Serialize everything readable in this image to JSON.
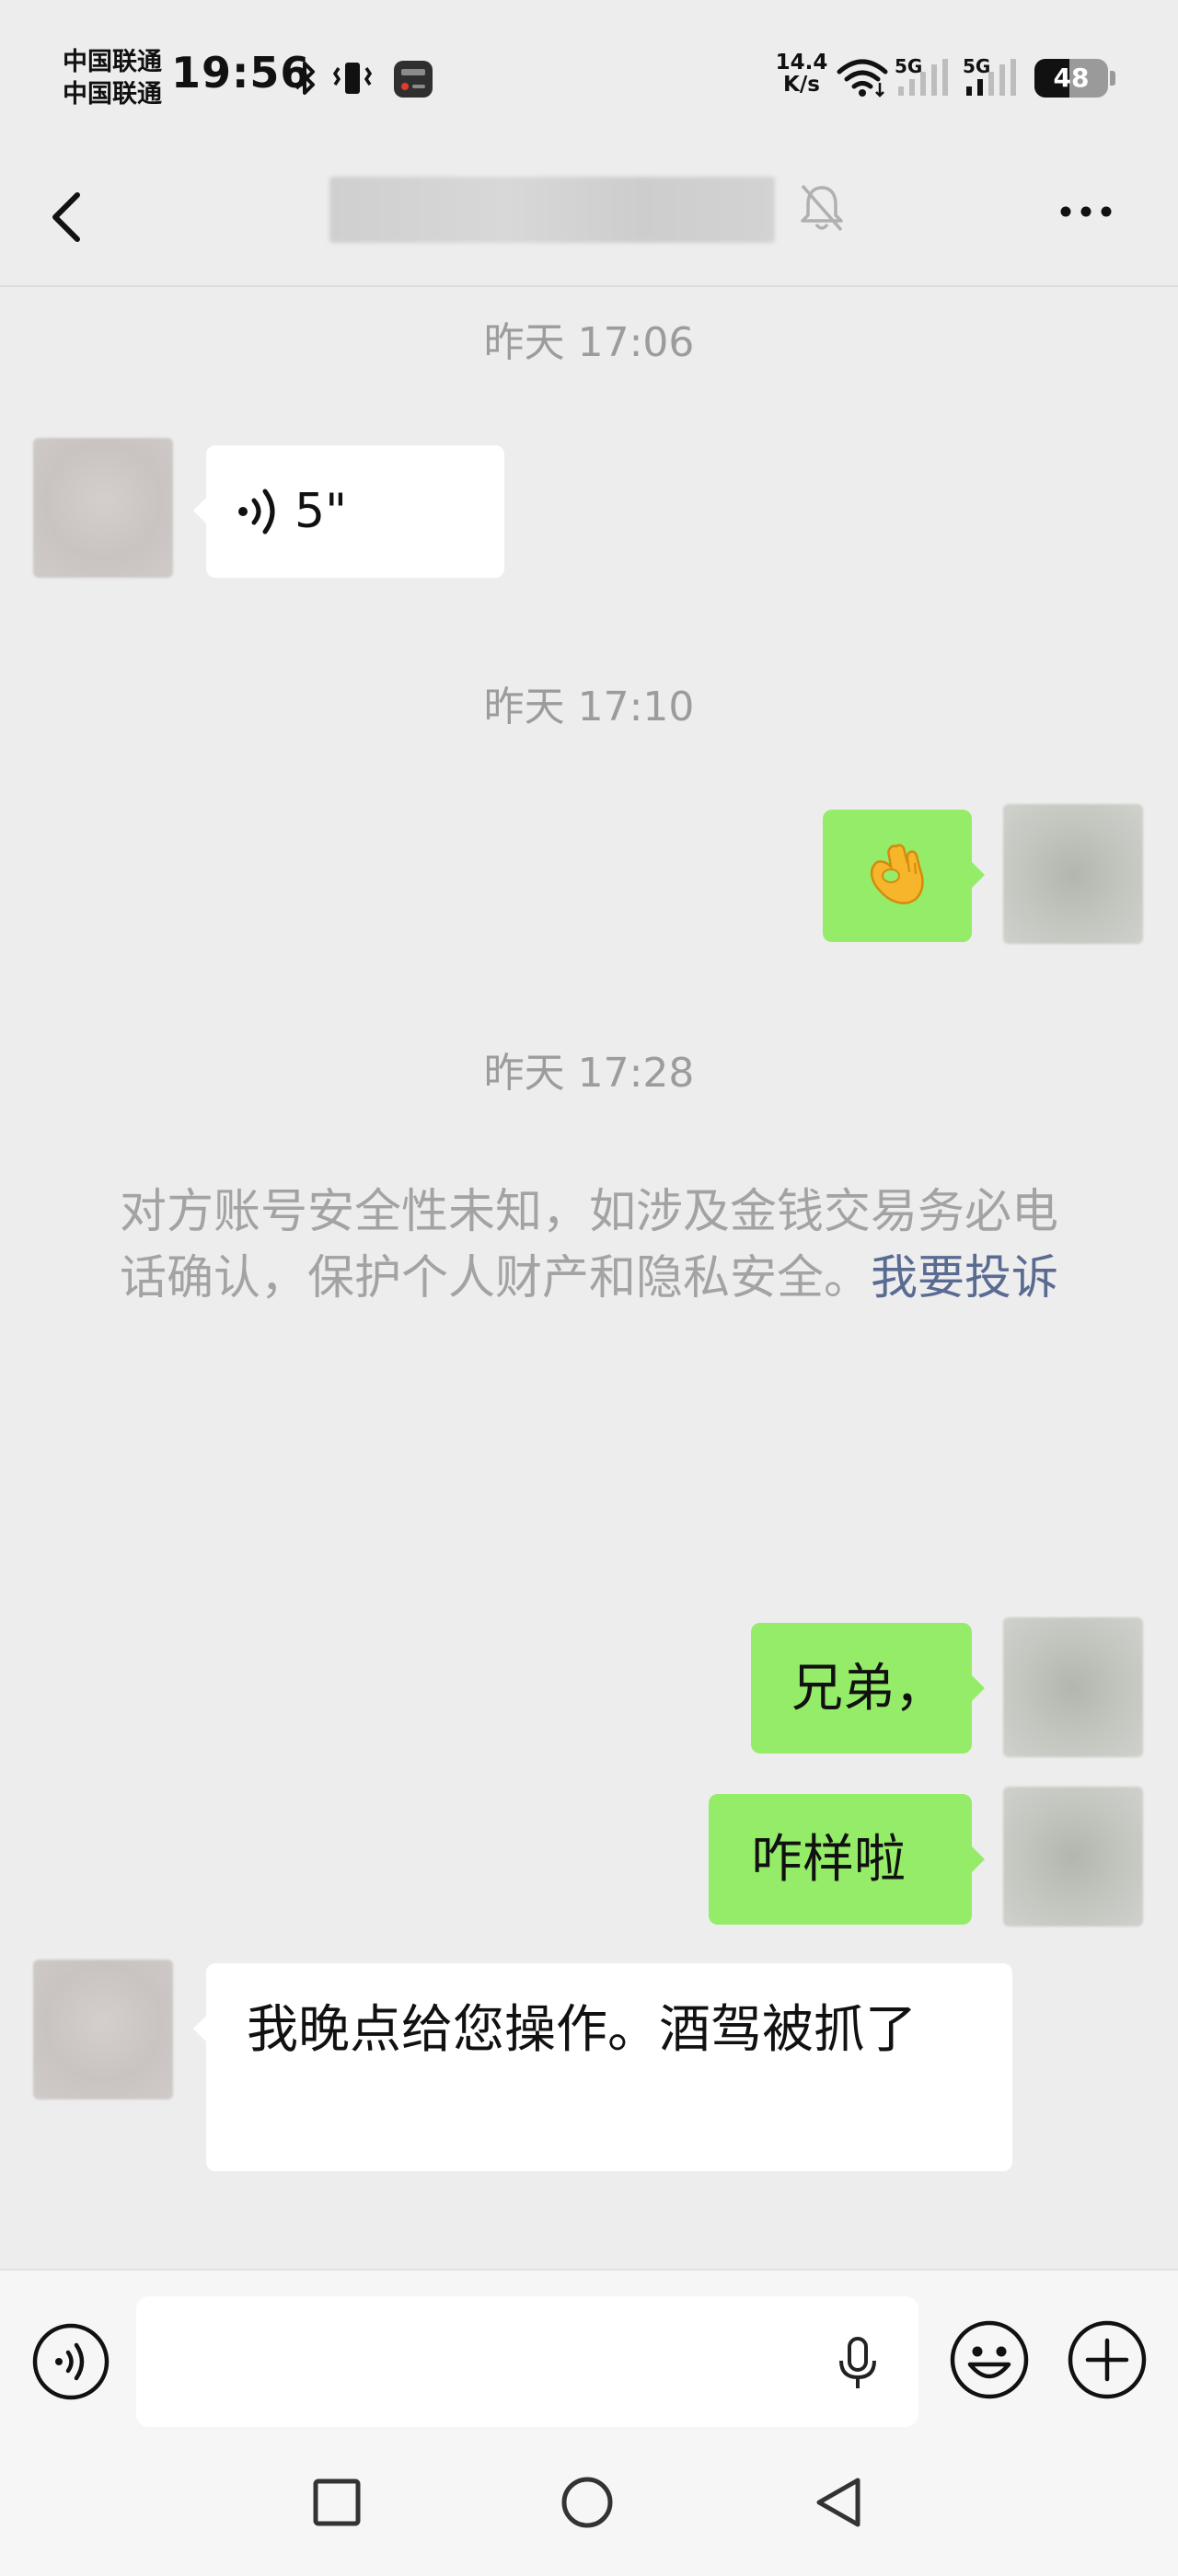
{
  "status_bar": {
    "carrier_1": "中国联通",
    "carrier_2": "中国联通",
    "time": "19:56",
    "net_speed_value": "14.4",
    "net_speed_unit": "K/s",
    "signal_1_label": "5G",
    "signal_2_label": "5G",
    "battery_level": "48",
    "battery_fraction": 0.48,
    "icons": [
      "bluetooth-icon",
      "vibrate-icon",
      "screen-record-icon",
      "wifi-icon",
      "signal-icon",
      "battery-icon"
    ]
  },
  "header": {
    "icons": [
      "back-icon",
      "mute-bell-icon",
      "more-icon"
    ]
  },
  "chat": {
    "timestamps": [
      "昨天 17:06",
      "昨天 17:10",
      "昨天 17:28"
    ],
    "voice_message": {
      "duration": "5\"",
      "icon": "voice-wave-icon"
    },
    "emoji_message": {
      "icon": "ok-hand-emoji"
    },
    "security_notice": {
      "text": "对方账号安全性未知，如涉及金钱交易务必电话确认，保护个人财产和隐私安全。",
      "link": "我要投诉"
    },
    "messages": [
      {
        "sender": "me",
        "text": "兄弟，"
      },
      {
        "sender": "me",
        "text": "咋样啦"
      },
      {
        "sender": "other",
        "text": "我晚点给您操作。酒驾被抓了"
      }
    ]
  },
  "input_bar": {
    "value": "",
    "icons": [
      "voice-mode-icon",
      "microphone-icon",
      "emoji-icon",
      "plus-icon"
    ]
  },
  "nav_bar": {
    "icons": [
      "recents-square-icon",
      "home-circle-icon",
      "back-triangle-icon"
    ]
  },
  "colors": {
    "background": "#ededed",
    "my_bubble": "#95ec69",
    "other_bubble": "#ffffff",
    "link": "#5a6b92",
    "timestamp": "#9c9c9c"
  }
}
